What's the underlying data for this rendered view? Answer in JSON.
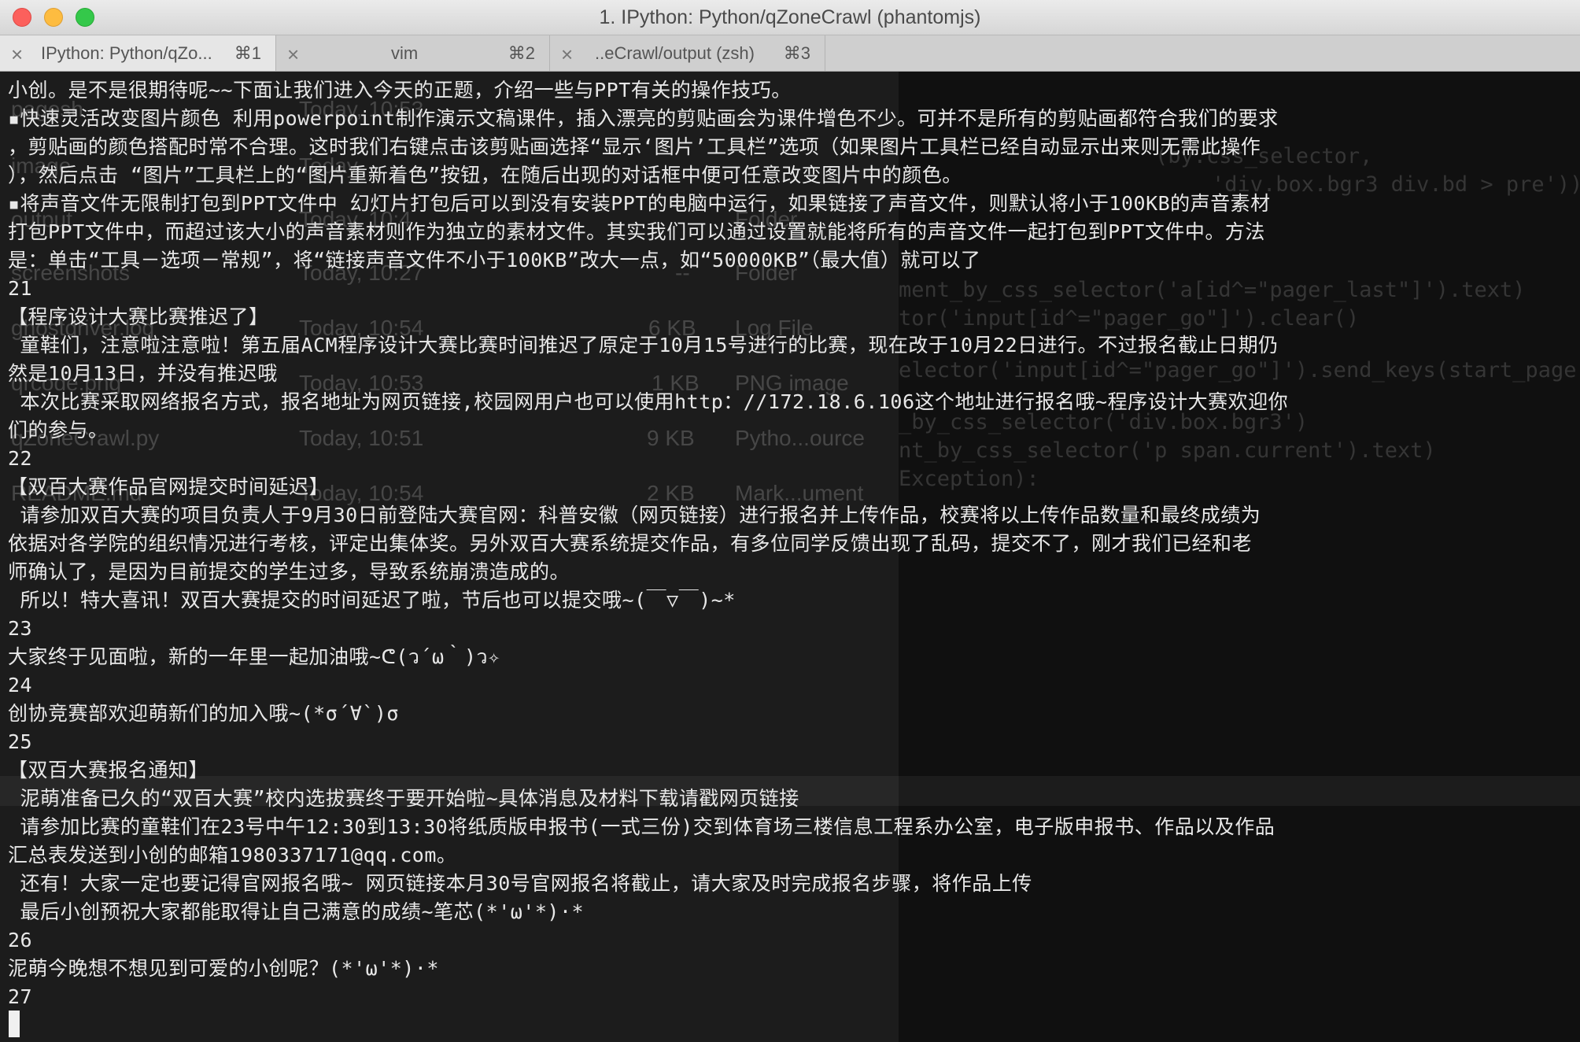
{
  "window": {
    "title": "1. IPython: Python/qZoneCrawl (phantomjs)"
  },
  "tabs": [
    {
      "close": "×",
      "label": "IPython: Python/qZo...",
      "shortcut": "⌘1",
      "active": true
    },
    {
      "close": "×",
      "label": "vim",
      "shortcut": "⌘2",
      "active": false
    },
    {
      "close": "×",
      "label": "..eCrawl/output (zsh)",
      "shortcut": "⌘3",
      "active": false
    }
  ],
  "background_finder": {
    "rows": [
      {
        "name": "pagesh",
        "date": "Today, 10:53"
      },
      {
        "name": "image",
        "date": "Today"
      },
      {
        "name": "output",
        "date": "Today, 10:4",
        "kind": "Folder"
      },
      {
        "name": "screenshots",
        "date": "Today, 10:27",
        "size": "--",
        "kind": "Folder"
      },
      {
        "name": "ghostdriver.log",
        "date": "Today, 10:54",
        "size": "6 KB",
        "kind": "Log File"
      },
      {
        "name": "qrcode.png",
        "date": "Today, 10:53",
        "size": "1 KB",
        "kind": "PNG image"
      },
      {
        "name": "qZoneCrawl.py",
        "date": "Today, 10:51",
        "size": "9 KB",
        "kind": "Pytho...ource"
      },
      {
        "name": "README.md",
        "date": "Today, 10:54",
        "size": "2 KB",
        "kind": "Mark...ument"
      }
    ]
  },
  "background_code": {
    "lines": [
      "(by.css_selector,",
      "'div.box.bgr3 div.bd > pre')))",
      "ment_by_css_selector('a[id^=\"pager_last\"]').text)",
      "tor('input[id^=\"pager_go\"]').clear()",
      "elector('input[id^=\"pager_go\"]').send_keys(start_page)",
      "_by_css_selector('div.box.bgr3')",
      "nt_by_css_selector('p span.current').text)",
      "Exception):"
    ]
  },
  "terminal": {
    "lines": [
      "小创。是不是很期待呢~~下面让我们进入今天的正题，介绍一些与PPT有关的操作技巧。",
      "▪快速灵活改变图片颜色 利用powerpoint制作演示文稿课件，插入漂亮的剪贴画会为课件增色不少。可并不是所有的剪贴画都符合我们的要求",
      "，剪贴画的颜色搭配时常不合理。这时我们右键点击该剪贴画选择“显示‘图片’工具栏”选项（如果图片工具栏已经自动显示出来则无需此操作",
      "），然后点击 “图片”工具栏上的“图片重新着色”按钮，在随后出现的对话框中便可任意改变图片中的颜色。",
      "▪将声音文件无限制打包到PPT文件中 幻灯片打包后可以到没有安装PPT的电脑中运行，如果链接了声音文件，则默认将小于100KB的声音素材",
      "打包PPT文件中，而超过该大小的声音素材则作为独立的素材文件。其实我们可以通过设置就能将所有的声音文件一起打包到PPT文件中。方法",
      "是：单击“工具－选项－常规”，将“链接声音文件不小于100KB”改大一点，如“50000KB”（最大值）就可以了",
      "21",
      "【程序设计大赛比赛推迟了】",
      " 童鞋们，注意啦注意啦！第五届ACM程序设计大赛比赛时间推迟了原定于10月15号进行的比赛，现在改于10月22日进行。不过报名截止日期仍",
      "然是10月13日，并没有推迟哦",
      " 本次比赛采取网络报名方式，报名地址为网页链接,校园网用户也可以使用http：//172.18.6.106这个地址进行报名哦~程序设计大赛欢迎你",
      "们的参与。",
      "22",
      "【双百大赛作品官网提交时间延迟】",
      " 请参加双百大赛的项目负责人于9月30日前登陆大赛官网：科普安徽（网页链接）进行报名并上传作品，校赛将以上传作品数量和最终成绩为",
      "依据对各学院的组织情况进行考核，评定出集体奖。另外双百大赛系统提交作品，有多位同学反馈出现了乱码，提交不了，刚才我们已经和老",
      "师确认了，是因为目前提交的学生过多，导致系统崩溃造成的。",
      " 所以！特大喜讯！双百大赛提交的时间延迟了啦，节后也可以提交哦~(￣▽￣)~*",
      "23",
      "大家终于见面啦，新的一年里一起加油哦~ᕦ(ว´ω｀)ว✧",
      "24",
      "创协竞赛部欢迎萌新们的加入哦~(*σ´∀`)σ",
      "25",
      "【双百大赛报名通知】",
      " 泥萌准备已久的“双百大赛”校内选拔赛终于要开始啦~具体消息及材料下载请戳网页链接",
      " 请参加比赛的童鞋们在23号中午12:30到13:30将纸质版申报书(一式三份)交到体育场三楼信息工程系办公室，电子版申报书、作品以及作品",
      "汇总表发送到小创的邮箱1980337171@qq.com。",
      " 还有！大家一定也要记得官网报名哦~ 网页链接本月30号官网报名将截止，请大家及时完成报名步骤，将作品上传",
      " 最后小创预祝大家都能取得让自己满意的成绩~笔芯(*'ω'*)·*",
      "26",
      "泥萌今晚想不想见到可爱的小创呢？(*'ω'*)·*",
      "27"
    ]
  },
  "colors": {
    "terminal_bg": "#1c1c1c",
    "terminal_fg": "#e8e8e8",
    "titlebar_bg": "#e0e0e0",
    "close_btn": "#fc605c",
    "min_btn": "#fdbc40",
    "max_btn": "#34c84a"
  }
}
